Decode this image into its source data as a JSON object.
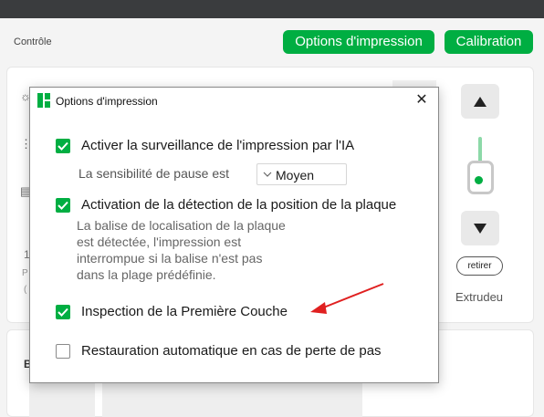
{
  "header": {
    "section_label": "Contrôle",
    "print_options_button": "Options d'impression",
    "calibration_button": "Calibration"
  },
  "background": {
    "retirer_button": "retirer",
    "extruder_label": "Extrudeu",
    "left_fragments": [
      "1",
      "P",
      "(",
      "B"
    ]
  },
  "dialog": {
    "title": "Options d'impression",
    "options": [
      {
        "label": "Activer la surveillance de l'impression par l'IA",
        "checked": true
      },
      {
        "label": "Activation de la détection de la position de la plaque",
        "checked": true
      },
      {
        "label": "Inspection de la Première Couche",
        "checked": true
      },
      {
        "label": "Restauration automatique en cas de perte de pas",
        "checked": false
      }
    ],
    "sensitivity_label": "La sensibilité de pause est",
    "sensitivity_value": "Moyen",
    "plate_description_lines": [
      "La balise de localisation de la plaque",
      "est détectée, l'impression est",
      "interrompue si la balise n'est pas",
      "dans la plage prédéfinie."
    ]
  },
  "colors": {
    "accent": "#00ae42",
    "annotation_arrow": "#e02020"
  }
}
